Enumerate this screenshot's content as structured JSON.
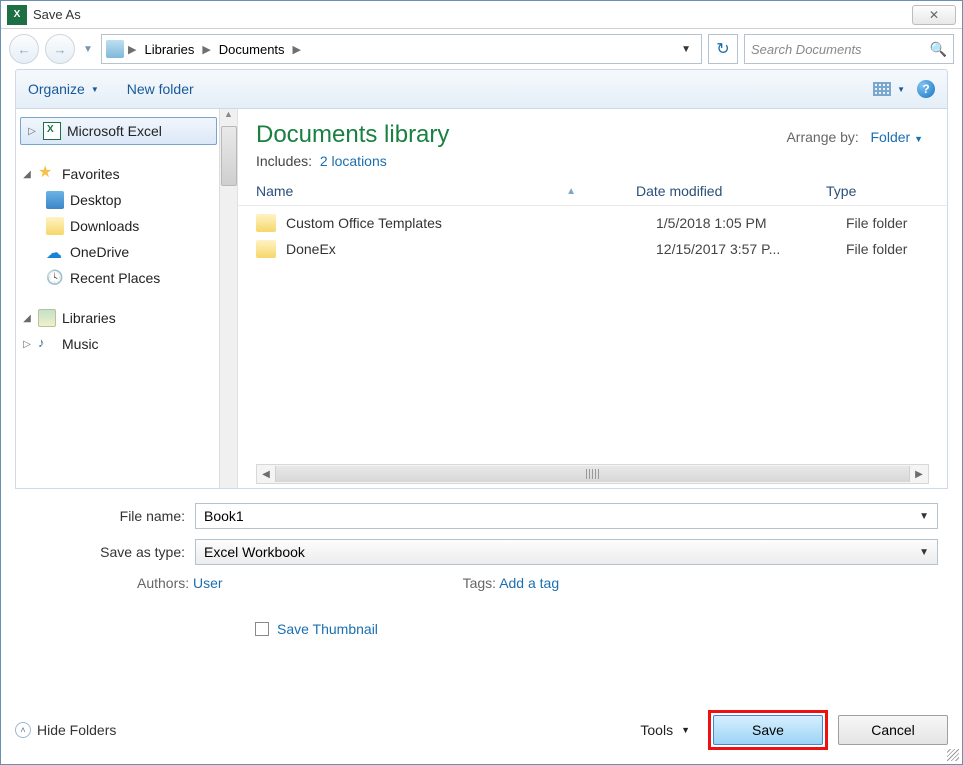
{
  "title": "Save As",
  "breadcrumb": {
    "seg1": "Libraries",
    "seg2": "Documents"
  },
  "search": {
    "placeholder": "Search Documents"
  },
  "toolbar": {
    "organize": "Organize",
    "new_folder": "New folder"
  },
  "sidebar": {
    "ms_excel": "Microsoft Excel",
    "favorites": "Favorites",
    "desktop": "Desktop",
    "downloads": "Downloads",
    "onedrive": "OneDrive",
    "recent": "Recent Places",
    "libraries": "Libraries",
    "music": "Music"
  },
  "library": {
    "title": "Documents library",
    "includes_label": "Includes:",
    "includes_link": "2 locations",
    "arrange_label": "Arrange by:",
    "arrange_value": "Folder"
  },
  "columns": {
    "name": "Name",
    "date": "Date modified",
    "type": "Type"
  },
  "rows": [
    {
      "name": "Custom Office Templates",
      "date": "1/5/2018 1:05 PM",
      "type": "File folder"
    },
    {
      "name": "DoneEx",
      "date": "12/15/2017 3:57 P...",
      "type": "File folder"
    }
  ],
  "form": {
    "filename_label": "File name:",
    "filename_value": "Book1",
    "type_label": "Save as type:",
    "type_value": "Excel Workbook",
    "authors_label": "Authors:",
    "authors_value": "User",
    "tags_label": "Tags:",
    "tags_value": "Add a tag",
    "thumbnail": "Save Thumbnail"
  },
  "footer": {
    "hide": "Hide Folders",
    "tools": "Tools",
    "save": "Save",
    "cancel": "Cancel"
  }
}
